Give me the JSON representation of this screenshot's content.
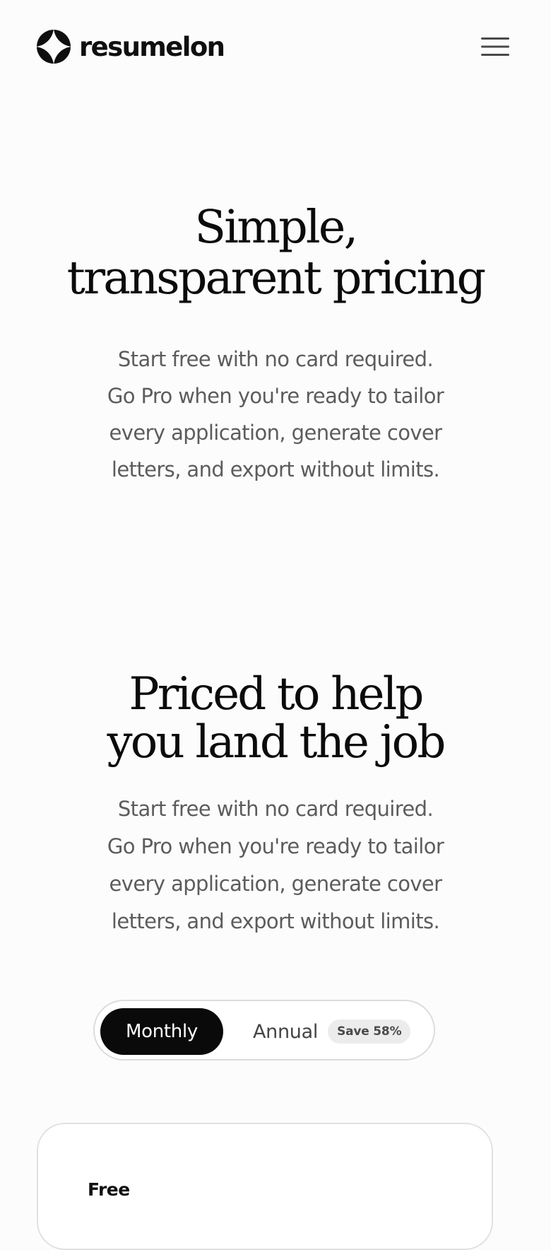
{
  "header": {
    "brand_name": "resumelon",
    "logo_icon": "diamond-logo-icon",
    "menu_icon": "hamburger-menu-icon"
  },
  "hero": {
    "title_lines": [
      "Simple,",
      "transparent pricing"
    ],
    "description_lines": [
      "Start free with no card required.",
      "Go Pro when you're ready to tailor",
      "every application, generate cover",
      "letters, and export without limits."
    ]
  },
  "pricing": {
    "title_lines": [
      "Priced to help",
      "you land the job"
    ],
    "description_lines": [
      "Start free with no card required.",
      "Go Pro when you're ready to tailor",
      "every application, generate cover",
      "letters, and export without limits."
    ],
    "billing_toggle": {
      "monthly_label": "Monthly",
      "annual_label": "Annual",
      "save_badge": "Save 58%",
      "selected": "Monthly"
    },
    "plans": [
      {
        "name": "Free"
      }
    ]
  },
  "colors": {
    "background": "#fcfcfc",
    "text_primary": "#0b0b0b",
    "text_secondary": "#5c5c5c",
    "toggle_active_bg": "#0a0a0a",
    "badge_bg": "#ececec",
    "border": "#dcdcdc"
  }
}
